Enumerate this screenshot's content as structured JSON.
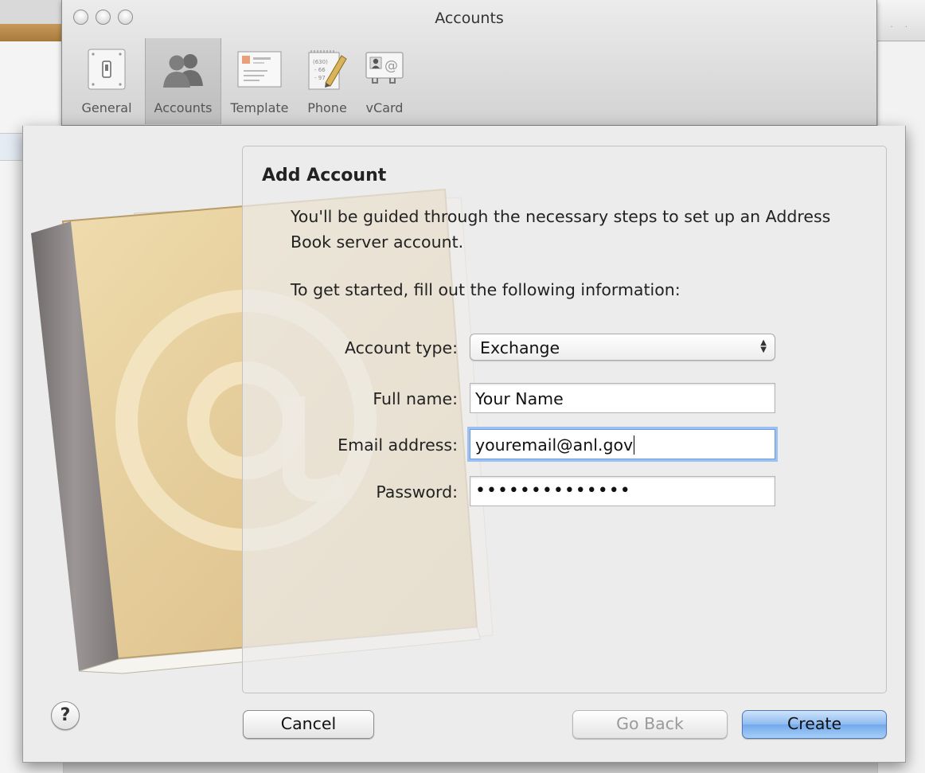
{
  "window": {
    "title": "Accounts"
  },
  "toolbar": {
    "items": [
      {
        "label": "General",
        "icon": "switch-icon"
      },
      {
        "label": "Accounts",
        "icon": "people-icon"
      },
      {
        "label": "Template",
        "icon": "card-template-icon"
      },
      {
        "label": "Phone",
        "icon": "notepad-pencil-icon"
      },
      {
        "label": "vCard",
        "icon": "vcard-icon"
      }
    ],
    "selected": "Accounts"
  },
  "sheet": {
    "title": "Add Account",
    "description": "You'll be guided through the necessary steps to set up an Address Book server account.",
    "prompt": "To get started, fill out the following information:",
    "fields": {
      "account_type_label": "Account type:",
      "account_type_value": "Exchange",
      "full_name_label": "Full name:",
      "full_name_value": "Your Name",
      "email_label": "Email address:",
      "email_value": "youremail@anl.gov",
      "password_label": "Password:",
      "password_value": "••••••••••••••"
    },
    "buttons": {
      "help": "?",
      "cancel": "Cancel",
      "go_back": "Go Back",
      "create": "Create"
    }
  },
  "colors": {
    "accent": "#72a9ec",
    "focus_ring": "#9cc1f0",
    "book_cover": "#e8d3a6",
    "book_spine": "#8a8483"
  }
}
